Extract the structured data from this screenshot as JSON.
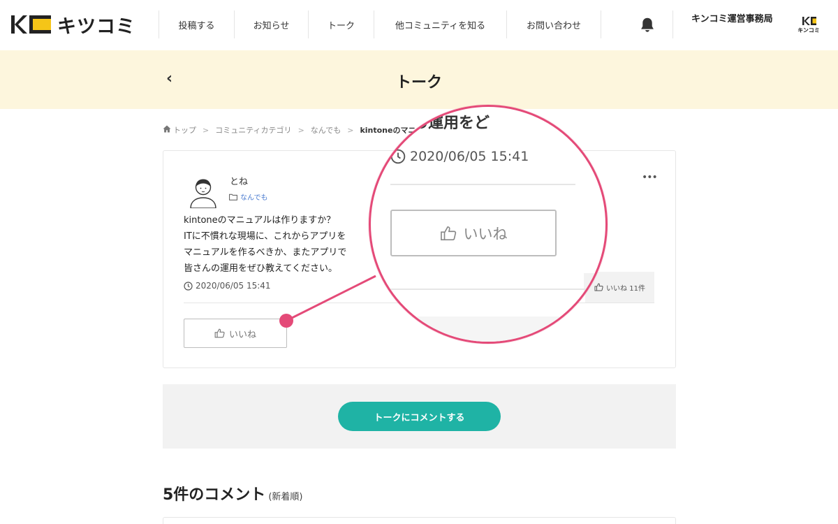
{
  "header": {
    "logo_text": "キツコミ",
    "nav": [
      {
        "label": "投稿する"
      },
      {
        "label": "お知らせ"
      },
      {
        "label": "トーク"
      },
      {
        "label": "他コミュニティを知る"
      },
      {
        "label": "お問い合わせ"
      }
    ],
    "bell_icon": "bell-icon",
    "org_name": "キンコミ運営事務局",
    "org_logo_text": "キンコミ"
  },
  "title_band": {
    "back_label": "‹",
    "title": "トーク"
  },
  "breadcrumb": {
    "items": [
      "トップ",
      "コミュニティカテゴリ",
      "なんでも"
    ],
    "current": "kintoneのマニュア"
  },
  "post": {
    "user": "とね",
    "category": "なんでも",
    "more_label": "•••",
    "lines": [
      "kintoneのマニュアルは作りますか？",
      "ITに不慣れな現場に、これからアプリを",
      "マニュアルを作るべきか、またアプリで",
      "皆さんの運用をぜひ教えてください。"
    ],
    "timestamp": "2020/06/05 15:41",
    "like_count_label": "いいね 11件",
    "like_button_label": "いいね"
  },
  "comment": {
    "button_label": "トークにコメントする"
  },
  "comments_section": {
    "heading": "5件のコメント",
    "sort_label": "(新着順)"
  },
  "magnifier": {
    "title_fragment": "の運用をど",
    "timestamp": "2020/06/05 15:41",
    "like_button_label": "いいね"
  },
  "colors": {
    "accent_teal": "#1fb3a5",
    "title_band": "#fdf6dd",
    "callout_pink": "#e44a78",
    "logo_yellow": "#f5c518",
    "tag_blue": "#4a7bd0"
  }
}
